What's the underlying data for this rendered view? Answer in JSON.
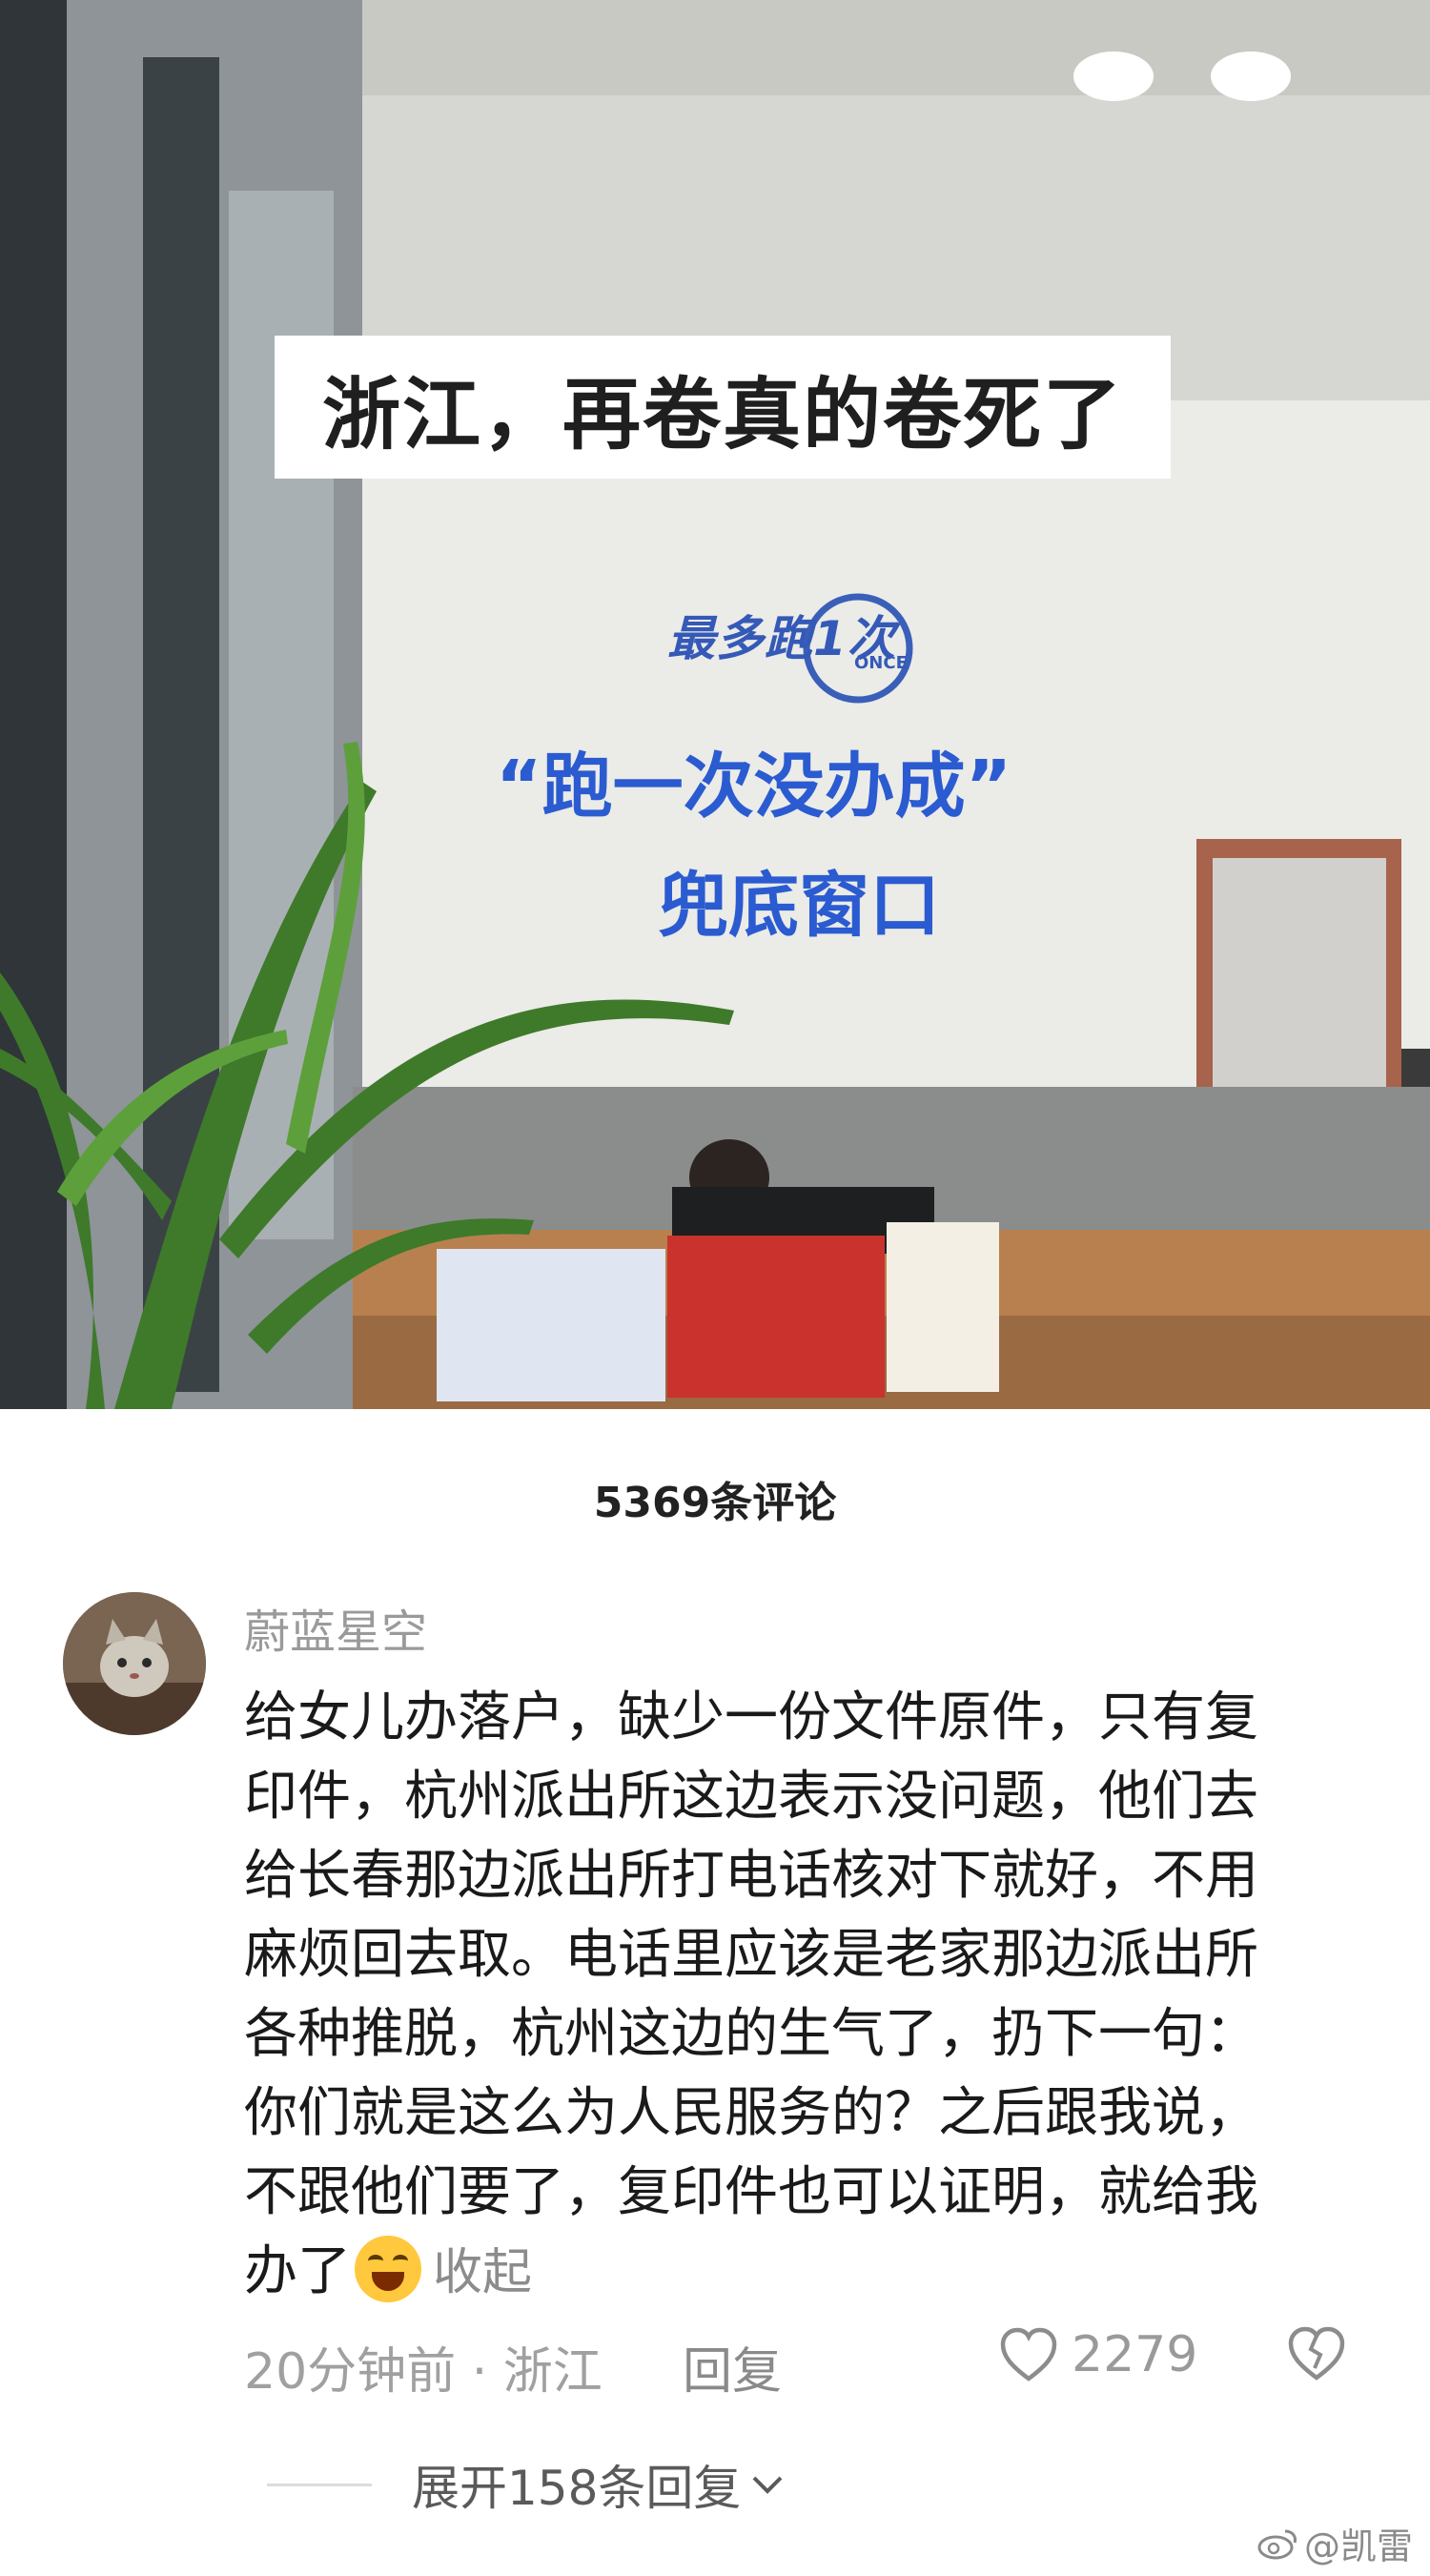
{
  "photo": {
    "banner": "浙江，再卷真的卷死了",
    "logo_text": "最多跑1次",
    "logo_once": "ONCE",
    "sign_line1": "“跑一次没办成”",
    "sign_line2": "兜底窗口"
  },
  "comments_header": "5369条评论",
  "comment": {
    "username": "蔚蓝星空",
    "lines": [
      "给女儿办落户，缺少一份文件原件，只有复",
      "印件，杭州派出所这边表示没问题，他们去",
      "给长春那边派出所打电话核对下就好，不用",
      "麻烦回去取。电话里应该是老家那边派出所",
      "各种推脱，杭州这边的生气了，扔下一句：",
      "你们就是这么为人民服务的？之后跟我说，",
      "不跟他们要了，复印件也可以证明，就给我",
      "办了"
    ],
    "collapse_label": "收起",
    "meta": "20分钟前 · 浙江",
    "reply_label": "回复",
    "like_count": "2279",
    "expand_label": "展开158条回复"
  },
  "watermark": "@凯雷",
  "colors": {
    "sign_blue": "#2b5bd0",
    "text_gray": "#9a9a9a"
  }
}
